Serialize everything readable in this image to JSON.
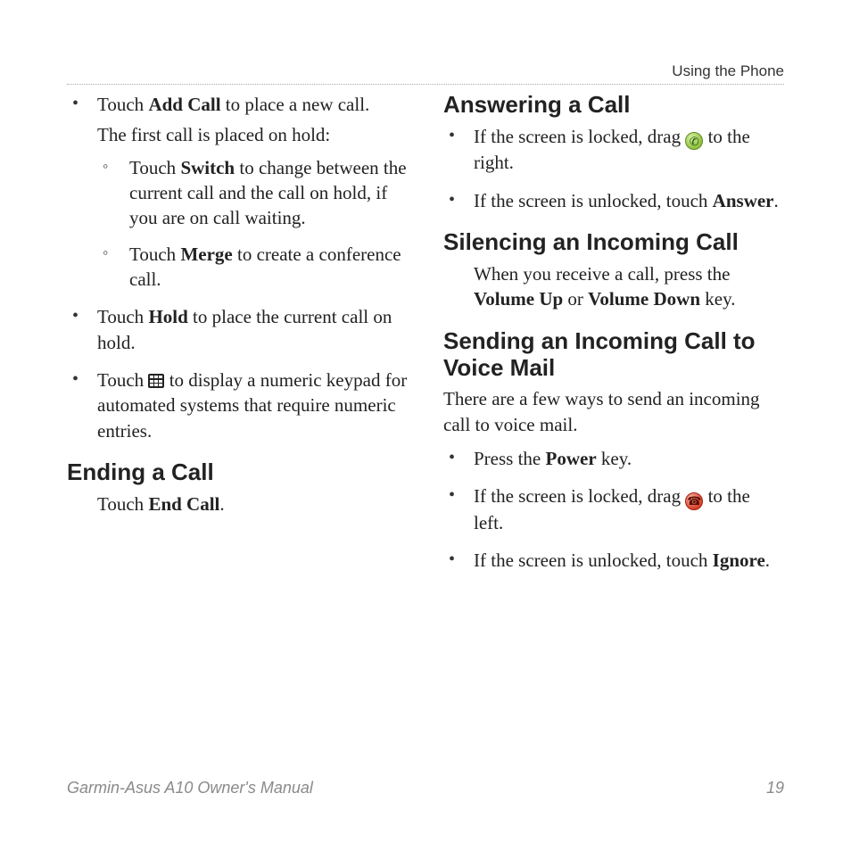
{
  "header": {
    "section": "Using the Phone"
  },
  "left": {
    "items": [
      {
        "pre": "Touch ",
        "bold": "Add Call",
        "post": " to place a new call.",
        "note": "The first call is placed on hold:",
        "sub": [
          {
            "pre": "Touch ",
            "bold": "Switch",
            "post": " to change between the current call and the call on hold, if you are on call waiting."
          },
          {
            "pre": "Touch ",
            "bold": "Merge",
            "post": " to create a conference call."
          }
        ]
      },
      {
        "pre": "Touch ",
        "bold": "Hold",
        "post": " to place the current call on hold."
      },
      {
        "pre": "Touch ",
        "icon": "keypad",
        "post": " to display a numeric keypad for automated systems that require numeric entries."
      }
    ],
    "ending": {
      "heading": "Ending a Call",
      "line_pre": "Touch ",
      "line_bold": "End Call",
      "line_post": "."
    }
  },
  "right": {
    "answering": {
      "heading": "Answering a Call",
      "items": [
        {
          "pre": "If the screen is locked, drag ",
          "icon": "answer",
          "post": " to the right."
        },
        {
          "pre": "If the screen is unlocked, touch ",
          "bold": "Answer",
          "post": "."
        }
      ]
    },
    "silencing": {
      "heading": "Silencing an Incoming Call",
      "line_pre": "When you receive a call, press the ",
      "line_b1": "Volume Up",
      "line_mid": " or ",
      "line_b2": "Volume Down",
      "line_post": " key."
    },
    "voicemail": {
      "heading": "Sending an Incoming Call to Voice Mail",
      "intro": "There are a few ways to send an incoming call to voice mail.",
      "items": [
        {
          "pre": "Press the ",
          "bold": "Power",
          "post": " key."
        },
        {
          "pre": "If the screen is locked, drag ",
          "icon": "reject",
          "post": " to the left."
        },
        {
          "pre": "If the screen is unlocked, touch ",
          "bold": "Ignore",
          "post": "."
        }
      ]
    }
  },
  "footer": {
    "manual": "Garmin-Asus A10 Owner's Manual",
    "page": "19"
  },
  "icons": {
    "answer_glyph": "✆",
    "reject_glyph": "☎"
  }
}
